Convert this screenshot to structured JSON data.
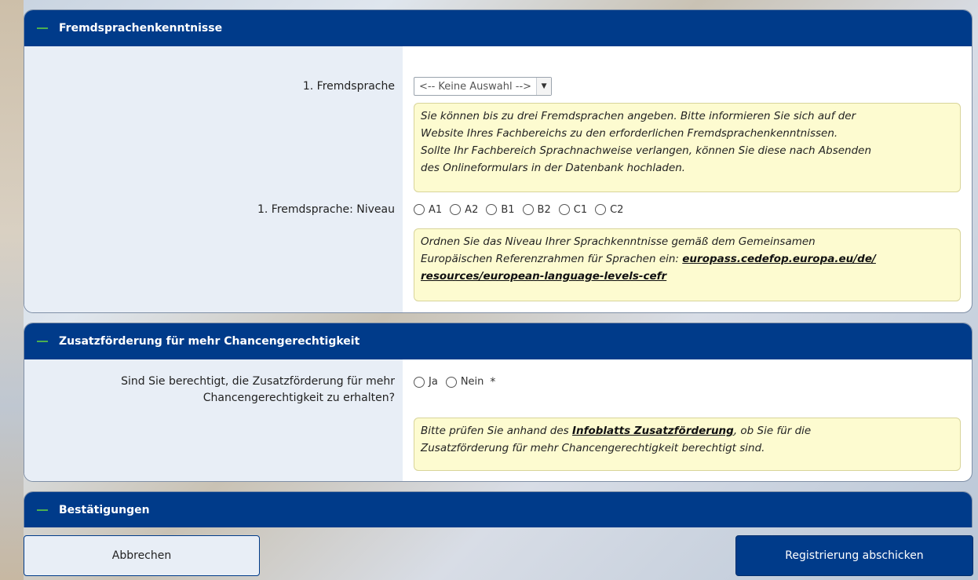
{
  "sections": {
    "fremdsprachen": {
      "title": "Fremdsprachenkenntnisse",
      "lang_label": "1. Fremdsprache",
      "lang_select_value": "<-- Keine Auswahl -->",
      "lang_hint_1": "Sie können bis zu drei Fremdsprachen angeben. Bitte informieren Sie sich auf der",
      "lang_hint_2": "Website Ihres Fachbereichs zu den erforderlichen Fremdsprachenkenntnissen.",
      "lang_hint_3": "Sollte Ihr Fachbereich Sprachnachweise verlangen, können Sie diese nach Absenden",
      "lang_hint_4": "des Onlineformulars in der Datenbank hochladen.",
      "level_label": "1. Fremdsprache: Niveau",
      "levels": [
        "A1",
        "A2",
        "B1",
        "B2",
        "C1",
        "C2"
      ],
      "level_hint_1": "Ordnen Sie das Niveau Ihrer Sprachkenntnisse gemäß dem Gemeinsamen",
      "level_hint_2": "Europäischen Referenzrahmen für Sprachen ein:",
      "level_link_1": "europass.cedefop.europa.eu/de/",
      "level_link_2": "resources/european-language-levels-cefr"
    },
    "zusatz": {
      "title": "Zusatzförderung für mehr Chancengerechtigkeit",
      "question_1": "Sind Sie berechtigt, die Zusatzförderung für mehr",
      "question_2": "Chancengerechtigkeit zu erhalten?",
      "options": [
        "Ja",
        "Nein"
      ],
      "required_mark": "*",
      "hint_pre": "Bitte prüfen Sie anhand des",
      "hint_link": "Infoblatts Zusatzförderung",
      "hint_post": ", ob Sie für die",
      "hint_2": "Zusatzförderung für mehr Chancengerechtigkeit berechtigt sind."
    },
    "bestaetigungen": {
      "title": "Bestätigungen"
    }
  },
  "buttons": {
    "cancel": "Abbrechen",
    "submit": "Registrierung abschicken"
  },
  "colors": {
    "header_bg": "#003b8a",
    "label_bg": "#e8eef6",
    "hint_bg": "#fdfbd0",
    "collapse_accent": "#4caf50"
  }
}
